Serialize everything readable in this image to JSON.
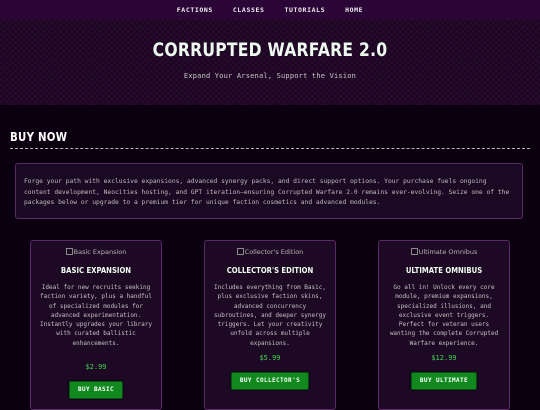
{
  "nav": {
    "items": [
      "FACTIONS",
      "CLASSES",
      "TUTORIALS",
      "HOME"
    ]
  },
  "hero": {
    "title": "CORRUPTED WARFARE 2.0",
    "subtitle": "Expand Your Arsenal, Support the Vision"
  },
  "buy": {
    "heading": "BUY NOW",
    "intro": "Forge your path with exclusive expansions, advanced synergy packs, and direct support options. Your purchase fuels ongoing content development, Neocities hosting, and GPT iteration—ensuring Corrupted Warfare 2.0 remains ever-evolving. Seize one of the packages below or upgrade to a premium tier for unique faction cosmetics and advanced modules."
  },
  "cards": [
    {
      "image_alt": "Basic Expansion",
      "title": "BASIC EXPANSION",
      "description": "Ideal for new recruits seeking faction variety, plus a handful of specialized modules for advanced experimentation. Instantly upgrades your library with curated ballistic enhancements.",
      "price": "$2.99",
      "button": "BUY BASIC"
    },
    {
      "image_alt": "Collector's Edition",
      "title": "COLLECTOR'S EDITION",
      "description": "Includes everything from Basic, plus exclusive faction skins, advanced concurrency subroutines, and deeper synergy triggers. Let your creativity unfold across multiple expansions.",
      "price": "$5.99",
      "button": "BUY COLLECTOR'S"
    },
    {
      "image_alt": "Ultimate Omnibus",
      "title": "ULTIMATE OMNIBUS",
      "description": "Go all in! Unlock every core module, premium expansions, specialized illusions, and exclusive event triggers. Perfect for veteran users wanting the complete Corrupted Warfare experience.",
      "price": "$12.99",
      "button": "BUY ULTIMATE"
    }
  ],
  "colors": {
    "background": "#0b000f",
    "nav_bg": "#2a0536",
    "hero_bg": "#2b0b33",
    "accent_green": "#3ddc50",
    "button_green": "#12891f",
    "card_border": "#5a2a66"
  }
}
